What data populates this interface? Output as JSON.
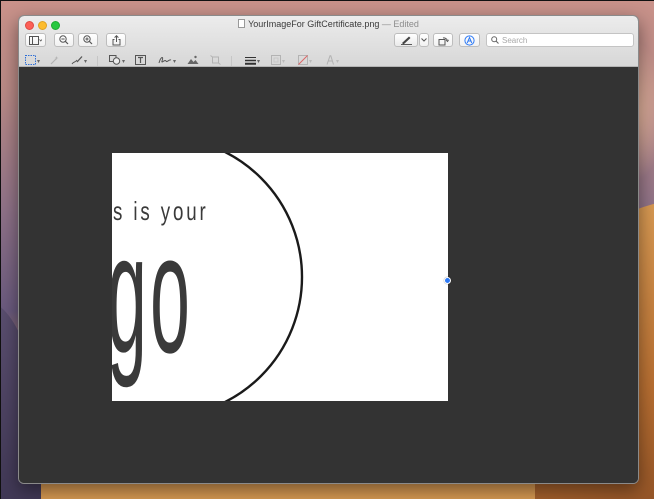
{
  "window": {
    "filename": "YourImageFor GiftCertificate.png",
    "status": "— Edited"
  },
  "toolbar": {
    "search_placeholder": "Search",
    "icons": [
      "sidebar-icon",
      "zoom-out-icon",
      "zoom-in-icon",
      "share-icon",
      "markup-pen-icon",
      "rotate-icon",
      "markup-toolbar-icon",
      "search-icon"
    ]
  },
  "markup_toolbar": {
    "tools": [
      "rectangular-selection",
      "instant-alpha",
      "sketch",
      "shapes",
      "text",
      "sign",
      "adjust-color",
      "adjust-size",
      "shape-style",
      "border-color",
      "fill-color",
      "text-style"
    ]
  },
  "canvas": {
    "text_line_1": "is is your",
    "text_line_2": "ogo"
  },
  "colors": {
    "window_bg": "#333333",
    "selection_handle": "#2f7bf6",
    "logo_ink": "#3a3a3a"
  }
}
